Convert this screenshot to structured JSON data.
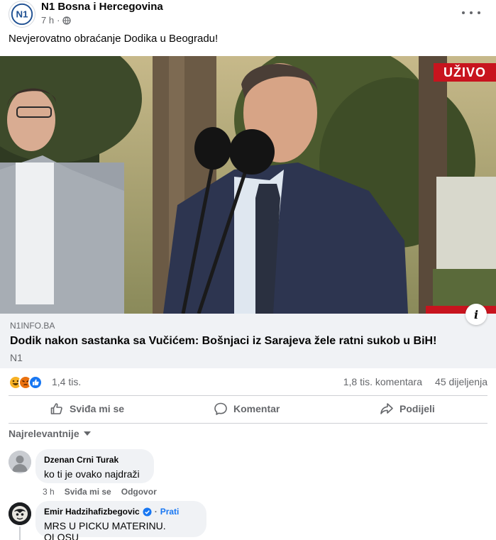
{
  "post": {
    "page_name": "N1 Bosna i Hercegovina",
    "time": "7 h",
    "separator": "·",
    "text": "Nevjerovatno obraćanje Dodika u Beogradu!"
  },
  "media": {
    "live_badge": "UŽIVO"
  },
  "link": {
    "domain": "N1INFO.BA",
    "title": "Dodik nakon sastanka sa Vučićem: Bošnjaci iz Sarajeva žele ratni sukob u BiH!",
    "source": "N1",
    "info_label": "i"
  },
  "stats": {
    "reactions": "1,4 tis.",
    "comments": "1,8 tis. komentara",
    "shares": "45 dijeljenja"
  },
  "actions": {
    "like": "Sviđa mi se",
    "comment": "Komentar",
    "share": "Podijeli"
  },
  "sort_label": "Najrelevantnije",
  "comments": [
    {
      "author": "Dzenan Crni Turak",
      "text": "ko ti je ovako najdraži",
      "time": "3 h",
      "like": "Sviđa mi se",
      "reply": "Odgovor"
    },
    {
      "author": "Emir Hadzihafizbegovic",
      "follow": "Prati",
      "text": "MRS U PICKU MATERINU. OLOSU"
    }
  ],
  "colors": {
    "accent": "#1877f2",
    "secondary_text": "#65676b",
    "live_red": "#c8141e",
    "link_box_bg": "#f0f2f5"
  },
  "icons": [
    "n1-logo-icon",
    "globe-icon",
    "more-icon",
    "info-icon",
    "haha-reaction-icon",
    "angry-reaction-icon",
    "like-reaction-icon",
    "thumbs-up-icon",
    "comment-icon",
    "share-icon",
    "caret-down-icon",
    "default-avatar-icon",
    "verified-badge-icon"
  ]
}
